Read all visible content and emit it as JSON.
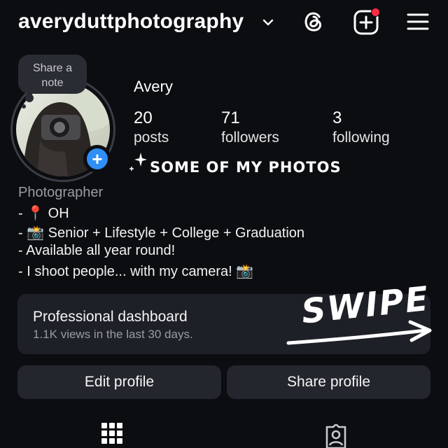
{
  "header": {
    "username": "averyduttphotography"
  },
  "note": {
    "text_line1": "Share a",
    "text_line2": "note"
  },
  "profile": {
    "display_name": "Avery",
    "stats": {
      "posts": {
        "count": "20",
        "label": "posts"
      },
      "followers": {
        "count": "71",
        "label": "followers"
      },
      "following": {
        "count": "3",
        "label": "following"
      }
    },
    "sticker_text": "SOME OF MY PHOTOS",
    "category": "Photographer",
    "bio": [
      "- 📍 OH",
      "- 📸 Senior + Lifestyle + College + Graduation",
      "- Available all year round!",
      "- I shoot people... with my camera! 📸"
    ]
  },
  "dashboard": {
    "title": "Professional dashboard",
    "subtitle": "1.1K views in the last 30 days.",
    "overlay_text": "SWIPE"
  },
  "buttons": {
    "edit_profile": "Edit profile",
    "share_profile": "Share profile"
  },
  "add_story_symbol": "+",
  "colors": {
    "background": "#0c0d11",
    "card": "#1e2027",
    "button": "#24262d",
    "accent_blue": "#2f8ff6",
    "notification_red": "#ff2a44",
    "muted_text": "#9a9ca3"
  },
  "icons": [
    "chevron-down-icon",
    "threads-icon",
    "create-post-icon",
    "menu-icon",
    "sparkle-icon",
    "grid-icon",
    "tagged-icon"
  ]
}
